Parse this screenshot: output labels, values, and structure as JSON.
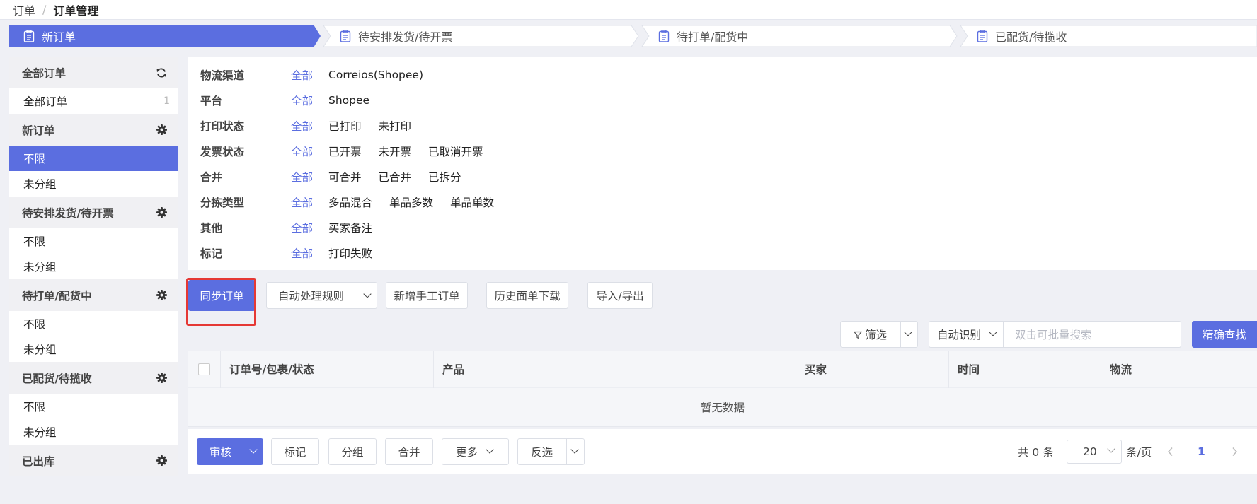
{
  "breadcrumb": {
    "root": "订单",
    "separator": "/",
    "current": "订单管理"
  },
  "steps": [
    {
      "label": "新订单",
      "active": true
    },
    {
      "label": "待安排发货/待开票",
      "active": false
    },
    {
      "label": "待打单/配货中",
      "active": false
    },
    {
      "label": "已配货/待揽收",
      "active": false
    }
  ],
  "sidebar": {
    "groups": [
      {
        "title": "全部订单",
        "icon": "refresh-icon",
        "items": [
          {
            "label": "全部订单",
            "count": "1"
          }
        ]
      },
      {
        "title": "新订单",
        "icon": "gear-icon",
        "items": [
          {
            "label": "不限",
            "active": true
          },
          {
            "label": "未分组"
          }
        ]
      },
      {
        "title": "待安排发货/待开票",
        "icon": "gear-icon",
        "items": [
          {
            "label": "不限"
          },
          {
            "label": "未分组"
          }
        ]
      },
      {
        "title": "待打单/配货中",
        "icon": "gear-icon",
        "items": [
          {
            "label": "不限"
          },
          {
            "label": "未分组"
          }
        ]
      },
      {
        "title": "已配货/待揽收",
        "icon": "gear-icon",
        "items": [
          {
            "label": "不限"
          },
          {
            "label": "未分组"
          }
        ]
      },
      {
        "title": "已出库",
        "icon": "gear-icon",
        "items": []
      }
    ]
  },
  "filters": [
    {
      "label": "物流渠道",
      "all": "全部",
      "options": [
        "Correios(Shopee)"
      ]
    },
    {
      "label": "平台",
      "all": "全部",
      "options": [
        "Shopee"
      ]
    },
    {
      "label": "打印状态",
      "all": "全部",
      "options": [
        "已打印",
        "未打印"
      ]
    },
    {
      "label": "发票状态",
      "all": "全部",
      "options": [
        "已开票",
        "未开票",
        "已取消开票"
      ]
    },
    {
      "label": "合并",
      "all": "全部",
      "options": [
        "可合并",
        "已合并",
        "已拆分"
      ]
    },
    {
      "label": "分拣类型",
      "all": "全部",
      "options": [
        "多品混合",
        "单品多数",
        "单品单数"
      ]
    },
    {
      "label": "其他",
      "all": "全部",
      "options": [
        "买家备注"
      ]
    },
    {
      "label": "标记",
      "all": "全部",
      "options": [
        "打印失败"
      ]
    }
  ],
  "toolbar": {
    "sync": "同步订单",
    "auto_rules": "自动处理规则",
    "add_manual": "新增手工订单",
    "history_download": "历史面单下载",
    "import_export": "导入/导出"
  },
  "search": {
    "filter": "筛选",
    "mode": "自动识别",
    "placeholder": "双击可批量搜索",
    "exact": "精确查找"
  },
  "table": {
    "columns": [
      "订单号/包裹/状态",
      "产品",
      "买家",
      "时间",
      "物流"
    ],
    "empty": "暂无数据"
  },
  "footer": {
    "review": "审核",
    "mark": "标记",
    "group": "分组",
    "merge": "合并",
    "more": "更多",
    "invert": "反选",
    "total": "共 0 条",
    "page_size": "20",
    "per_page": "条/页",
    "current_page": "1"
  },
  "colors": {
    "accent": "#5b6ee0",
    "highlight": "#e53935"
  }
}
